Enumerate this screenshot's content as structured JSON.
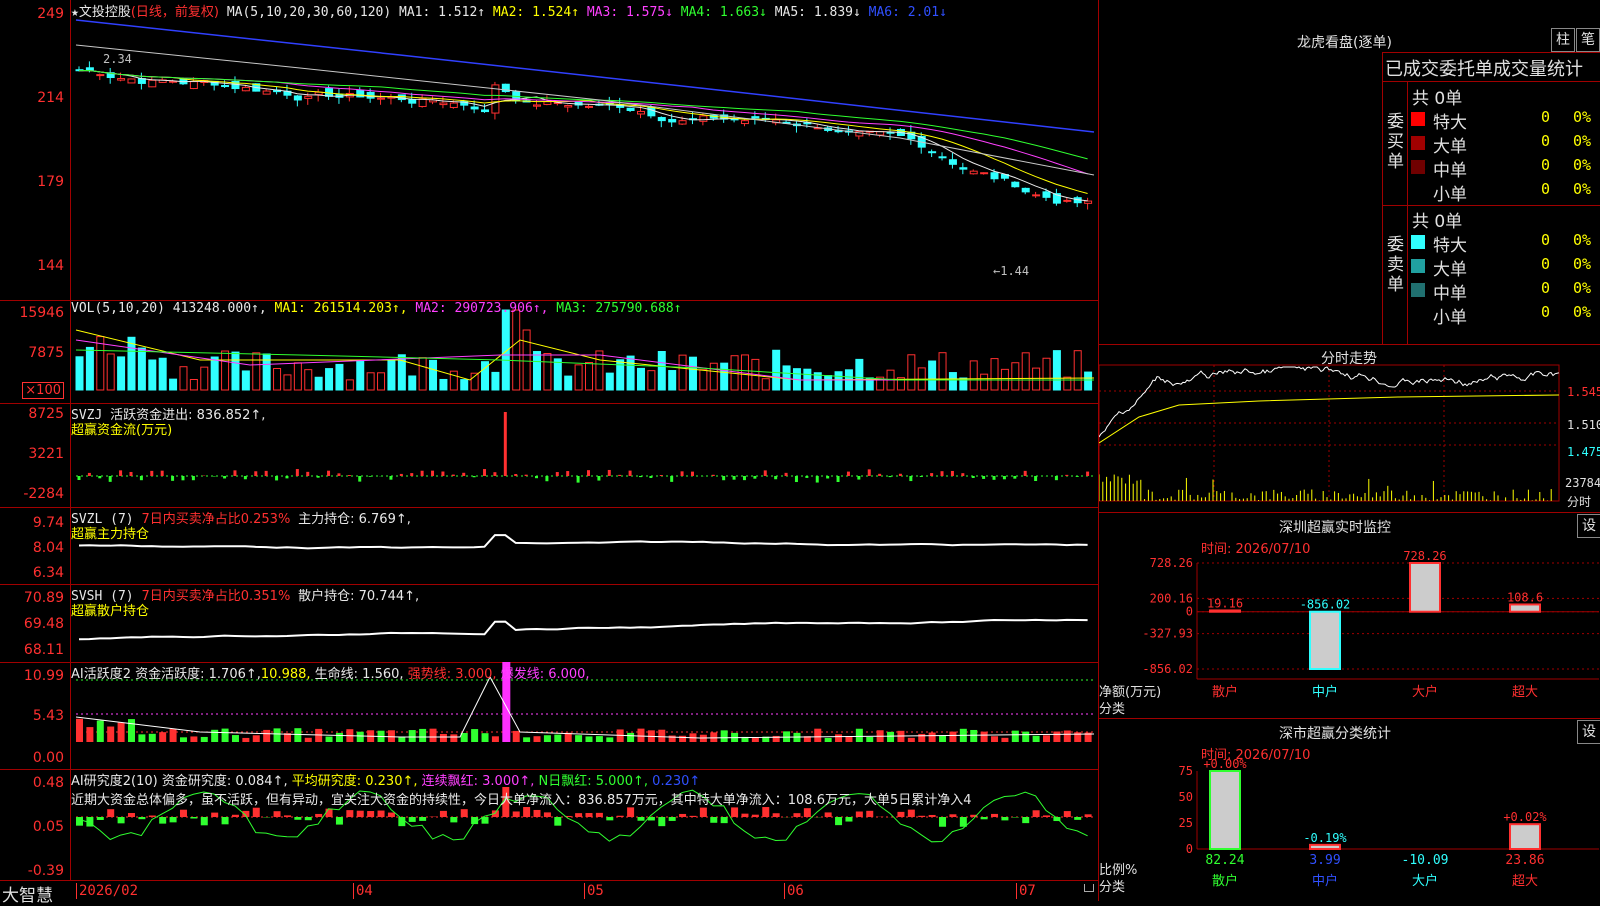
{
  "stock": {
    "name": "★文投控股",
    "mode": "(日线，前复权)",
    "ma_label": "MA(5,10,20,30,60,120)",
    "ma": [
      {
        "label": "MA1:",
        "value": "1.512↑",
        "color": "#e8e8e8"
      },
      {
        "label": "MA2:",
        "value": "1.524↑",
        "color": "#ffff00"
      },
      {
        "label": "MA3:",
        "value": "1.575↓",
        "color": "#ff40ff"
      },
      {
        "label": "MA4:",
        "value": "1.663↓",
        "color": "#30ff30"
      },
      {
        "label": "MA5:",
        "value": "1.839↓",
        "color": "#e8e8e8"
      },
      {
        "label": "MA6:",
        "value": "2.01↓",
        "color": "#3050ff"
      }
    ],
    "price_labels": [
      "249",
      "214",
      "179",
      "144"
    ],
    "high_marker": "2.34",
    "low_marker": "←1.44"
  },
  "volume": {
    "title": "VOL(5,10,20)",
    "value": "413248.000↑,",
    "ma1": "MA1: 261514.203↑,",
    "ma2": "MA2: 290723.906↑,",
    "ma3": "MA3: 275790.688↑",
    "labels": [
      "15946",
      "7875"
    ],
    "unit": "×100"
  },
  "svzj": {
    "title": "SVZJ",
    "line1": "活跃资金进出: 836.852↑,",
    "line2": "超赢资金流(万元)",
    "labels": [
      "8725",
      "3221",
      "-2284"
    ]
  },
  "svzl": {
    "title": "SVZL (7)",
    "ratio": "7日内买卖净占比0.253%",
    "hold": "主力持仓: 6.769↑,",
    "sub": "超赢主力持仓",
    "labels": [
      "9.74",
      "8.04",
      "6.34"
    ]
  },
  "svsh": {
    "title": "SVSH (7)",
    "ratio": "7日内买卖净占比0.351%",
    "hold": "散户持仓: 70.744↑,",
    "sub": "超赢散户持仓",
    "labels": [
      "70.89",
      "69.48",
      "68.11"
    ]
  },
  "ai_active": {
    "title": "AI活跃度2",
    "a": "资金活跃度: 1.706↑,",
    "b": "10.988,",
    "c": "生命线: 1.560,",
    "d": "强势线: 3.000,",
    "e": "爆发线: 6.000,",
    "labels": [
      "10.99",
      "5.43",
      "0.00"
    ]
  },
  "ai_research": {
    "title": "AI研究度2(10)",
    "a": "资金研究度: 0.084↑,",
    "b": "平均研究度: 0.230↑,",
    "c": "连续飘红: 3.000↑,",
    "d": "N日飘红: 5.000↑,",
    "e": "0.230↑",
    "comment": "近期大资金总体偏多，虽不活跃，但有异动，宜关注大资金的持续性，今日大单净流入：836.857万元，其中特大单净流入：108.6万元，大单5日累计净入4",
    "labels": [
      "0.48",
      "0.05",
      "-0.39"
    ]
  },
  "date_axis": {
    "brand": "大智慧",
    "dates": [
      "2026/02",
      "04",
      "05",
      "06",
      "07"
    ]
  },
  "longhu": {
    "title": "龙虎看盘(逐单)",
    "btn1": "柱",
    "btn2": "笔",
    "header": "已成交委托单成交量统计",
    "buy_label": "委买单",
    "sell_label": "委卖单",
    "buy_total": "共 0单",
    "sell_total": "共 0单",
    "buy_rows": [
      {
        "name": "特大",
        "count": "0",
        "pct": "0%",
        "color": "#ff0000"
      },
      {
        "name": "大单",
        "count": "0",
        "pct": "0%",
        "color": "#a00000"
      },
      {
        "name": "中单",
        "count": "0",
        "pct": "0%",
        "color": "#700000"
      },
      {
        "name": "小单",
        "count": "0",
        "pct": "0%",
        "color": ""
      }
    ],
    "sell_rows": [
      {
        "name": "特大",
        "count": "0",
        "pct": "0%",
        "color": "#30ffff"
      },
      {
        "name": "大单",
        "count": "0",
        "pct": "0%",
        "color": "#20a0a0"
      },
      {
        "name": "中单",
        "count": "0",
        "pct": "0%",
        "color": "#207070"
      },
      {
        "name": "小单",
        "count": "0",
        "pct": "0%",
        "color": ""
      }
    ]
  },
  "fenshi": {
    "title": "分时走势",
    "labels": [
      "1.545",
      "1.510",
      "1.475"
    ],
    "vol_label": "23784",
    "unit": "分时"
  },
  "sz_monitor": {
    "title": "深圳超赢实时监控",
    "btn": "设",
    "time": "时间: 2026/07/10",
    "axis": [
      "728.26",
      "200.16",
      "0",
      "-327.93",
      "-856.02"
    ],
    "ylabel": "净额(万元)",
    "xlabel": "分类",
    "categories": [
      "散户",
      "中户",
      "大户",
      "超大"
    ],
    "values": [
      "19.16",
      "-856.02",
      "728.26",
      "108.6"
    ]
  },
  "sz_class": {
    "title": "深市超赢分类统计",
    "btn": "设",
    "time": "时间: 2026/07/10",
    "axis": [
      "75",
      "50",
      "25",
      "0"
    ],
    "ylabel": "比例%",
    "xlabel": "分类",
    "categories": [
      "散户",
      "中户",
      "大户",
      "超大"
    ],
    "top": [
      "+0.00%",
      "-0.19%",
      "",
      "+0.02%"
    ],
    "bottom": [
      "82.24",
      "3.99",
      "-10.09",
      "23.86"
    ]
  },
  "chart_data": {
    "type": "bar",
    "title": "深圳超赢实时监控",
    "categories": [
      "散户",
      "中户",
      "大户",
      "超大"
    ],
    "values": [
      19.16,
      -856.02,
      728.26,
      108.6
    ],
    "ylabel": "净额(万元)",
    "xlabel": "分类",
    "ylim": [
      -856.02,
      728.26
    ]
  }
}
